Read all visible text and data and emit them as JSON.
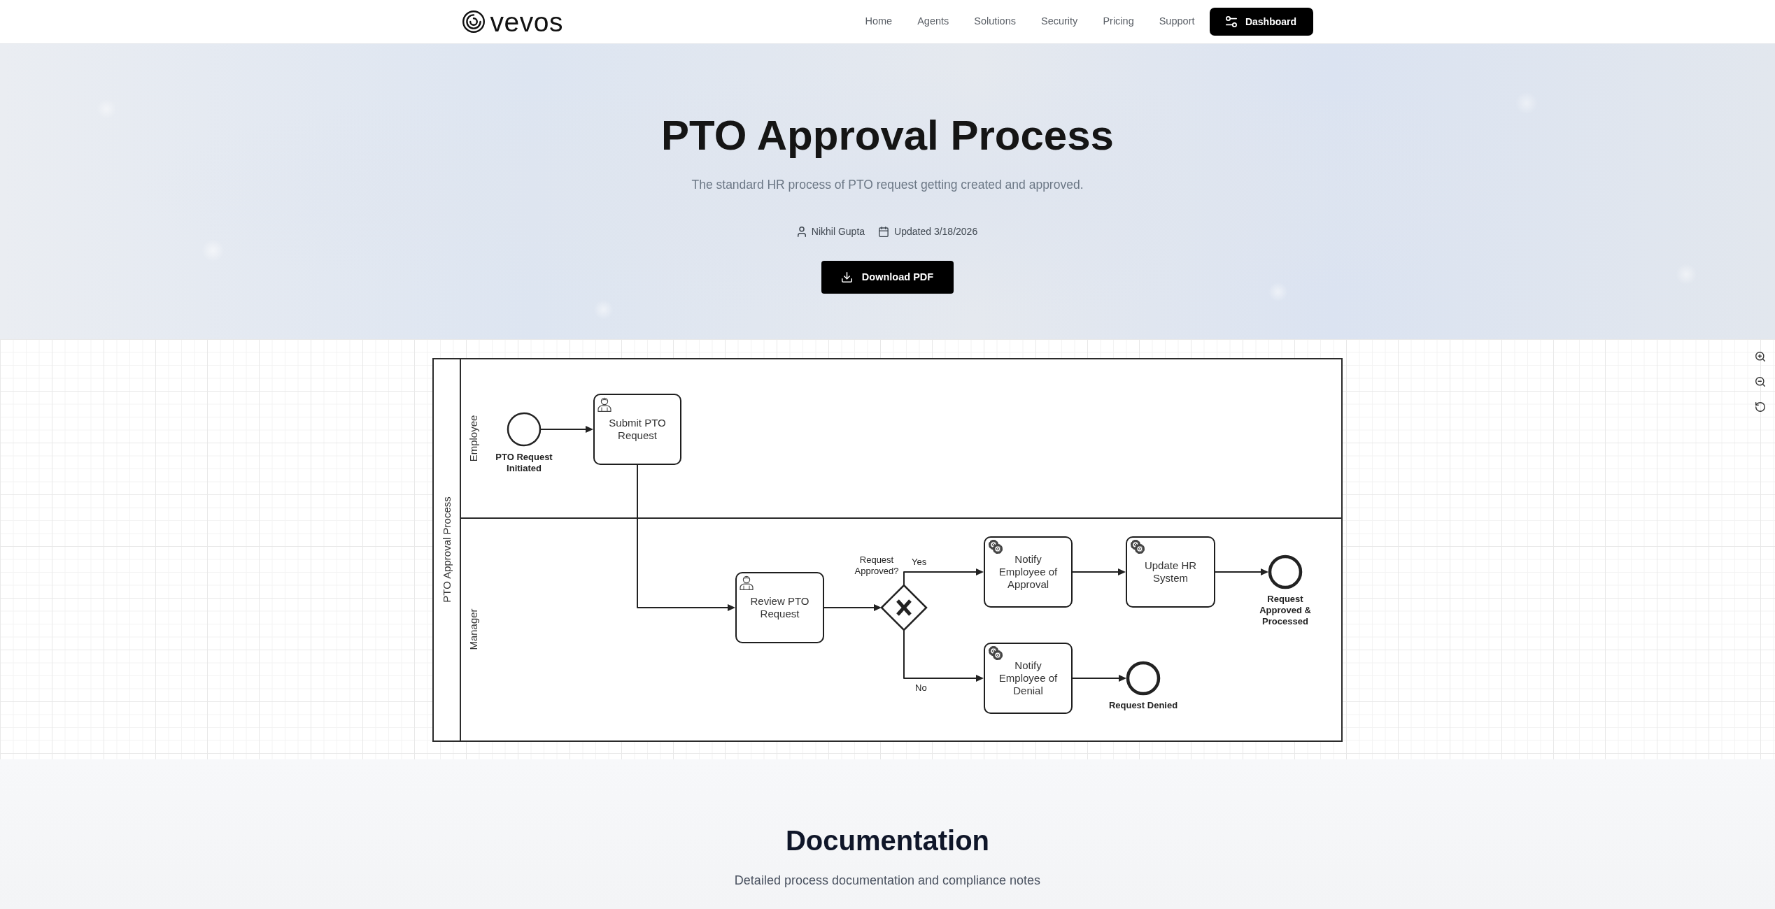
{
  "navbar": {
    "logo_text": "vevos",
    "links": [
      "Home",
      "Agents",
      "Solutions",
      "Security",
      "Pricing",
      "Support"
    ],
    "dashboard_button": "Dashboard"
  },
  "hero": {
    "title": "PTO Approval Process",
    "subtitle": "The standard HR process of PTO request getting created and approved.",
    "author": "Nikhil Gupta",
    "updated": "Updated 3/18/2026",
    "download_button": "Download PDF"
  },
  "diagram": {
    "pool_label": "PTO Approval Process",
    "lanes": [
      "Employee",
      "Manager"
    ],
    "nodes": [
      {
        "kind": "start_event",
        "label": "PTO Request Initiated"
      },
      {
        "kind": "user_task",
        "label": "Submit PTO Request"
      },
      {
        "kind": "user_task",
        "label": "Review PTO Request"
      },
      {
        "kind": "gateway",
        "label": "Request Approved?",
        "branch_labels": [
          "Yes",
          "No"
        ]
      },
      {
        "kind": "service_task",
        "label": "Notify Employee of Approval"
      },
      {
        "kind": "service_task",
        "label": "Update HR System"
      },
      {
        "kind": "end_event",
        "label": "Request Approved & Processed"
      },
      {
        "kind": "service_task",
        "label": "Notify Employee of Denial"
      },
      {
        "kind": "end_event",
        "label": "Request Denied"
      }
    ],
    "zoom_controls": [
      {
        "kind": "zoom_in"
      },
      {
        "kind": "zoom_out"
      },
      {
        "kind": "reset"
      }
    ]
  },
  "documentation": {
    "title": "Documentation",
    "subtitle": "Detailed process documentation and compliance notes"
  }
}
